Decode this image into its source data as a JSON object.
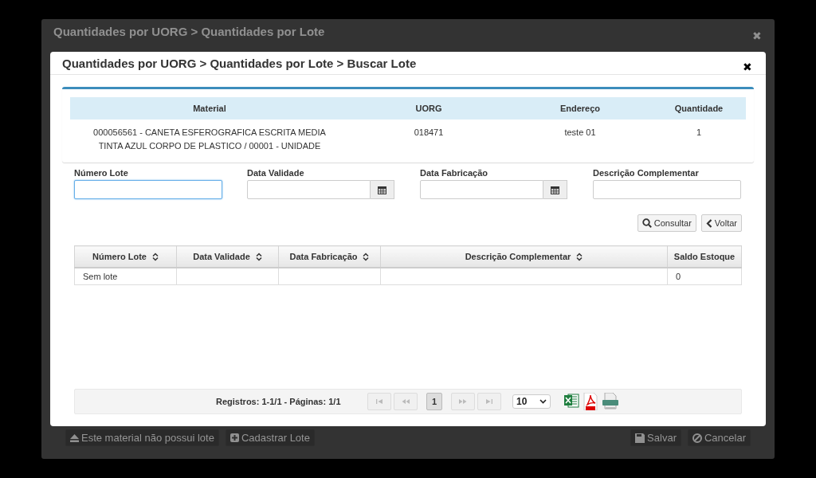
{
  "background_dialog": {
    "title": "Quantidades por UORG > Quantidades por Lote",
    "close": "✖",
    "footer_left": [
      {
        "label": "Este material não possui lote",
        "kind": "eject"
      },
      {
        "label": "Cadastrar Lote",
        "kind": "add"
      }
    ],
    "footer_right": [
      {
        "label": "Salvar",
        "kind": "save"
      },
      {
        "label": "Cancelar",
        "kind": "cancel"
      }
    ]
  },
  "dialog": {
    "title": "Quantidades por UORG > Quantidades por Lote > Buscar Lote",
    "close": "✖",
    "material_table": {
      "columns": [
        "Material",
        "UORG",
        "Endereço",
        "Quantidade"
      ],
      "rows": [
        [
          "000056561 - CANETA ESFEROGRAFICA ESCRITA MEDIA TINTA AZUL CORPO DE PLASTICO / 00001 - UNIDADE",
          "018471",
          "teste 01",
          "1"
        ]
      ]
    },
    "filters": [
      {
        "label": "Número Lote",
        "kind": "text",
        "focused": true
      },
      {
        "label": "Data Validade",
        "kind": "date",
        "focused": false
      },
      {
        "label": "Data Fabricação",
        "kind": "date",
        "focused": false
      },
      {
        "label": "Descrição Complementar",
        "kind": "text",
        "focused": false
      }
    ],
    "actions": [
      {
        "label": "Consultar",
        "kind": "search"
      },
      {
        "label": "Voltar",
        "kind": "back"
      }
    ],
    "results": {
      "columns": [
        {
          "label": "Número Lote",
          "sortable": true
        },
        {
          "label": "Data Validade",
          "sortable": true
        },
        {
          "label": "Data Fabricação",
          "sortable": true
        },
        {
          "label": "Descrição Complementar",
          "sortable": true
        },
        {
          "label": "Saldo Estoque",
          "sortable": false
        }
      ],
      "rows": [
        [
          "Sem lote",
          null,
          null,
          null,
          "0"
        ]
      ]
    },
    "pagination": {
      "summary": "Registros: 1-1/1 - Páginas: 1/1",
      "nav": [
        {
          "kind": "first",
          "disabled": true
        },
        {
          "kind": "prev",
          "disabled": true
        },
        {
          "kind": "page",
          "label": "1",
          "selected": true
        },
        {
          "kind": "next",
          "disabled": true
        },
        {
          "kind": "last",
          "disabled": true
        }
      ],
      "page_size": "10",
      "exports": [
        {
          "kind": "excel"
        },
        {
          "kind": "pdf"
        },
        {
          "kind": "csv"
        }
      ]
    }
  }
}
